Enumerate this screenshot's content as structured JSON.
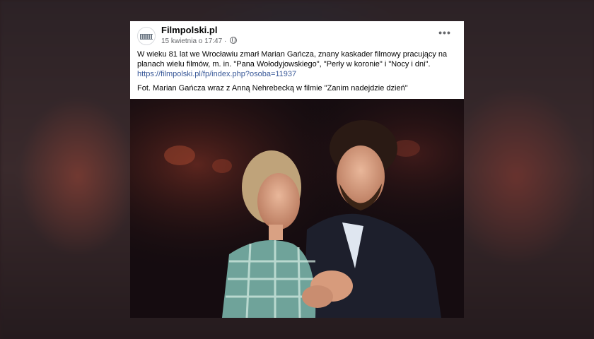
{
  "post": {
    "page_name": "Filmpolski.pl",
    "timestamp": "15 kwietnia o 17:47",
    "privacy_separator": "·",
    "more_label": "•••",
    "text_line": "W wieku 81 lat we Wrocławiu zmarł Marian Gańcza, znany kaskader filmowy pracujący na planach wielu filmów, m. in. \"Pana Wołodyjowskiego\", \"Perły w koronie\" i \"Nocy i dni\".",
    "link": "https://filmpolski.pl/fp/index.php?osoba=11937",
    "caption": "Fot. Marian Gańcza wraz z Anną Nehrebecką w filmie \"Zanim nadejdzie dzień\""
  },
  "icons": {
    "page_logo": "filmstrip-logo-icon",
    "privacy": "globe-icon",
    "more": "more-options-icon"
  },
  "colors": {
    "link": "#385898",
    "meta_text": "#65676b",
    "primary_text": "#050505"
  }
}
